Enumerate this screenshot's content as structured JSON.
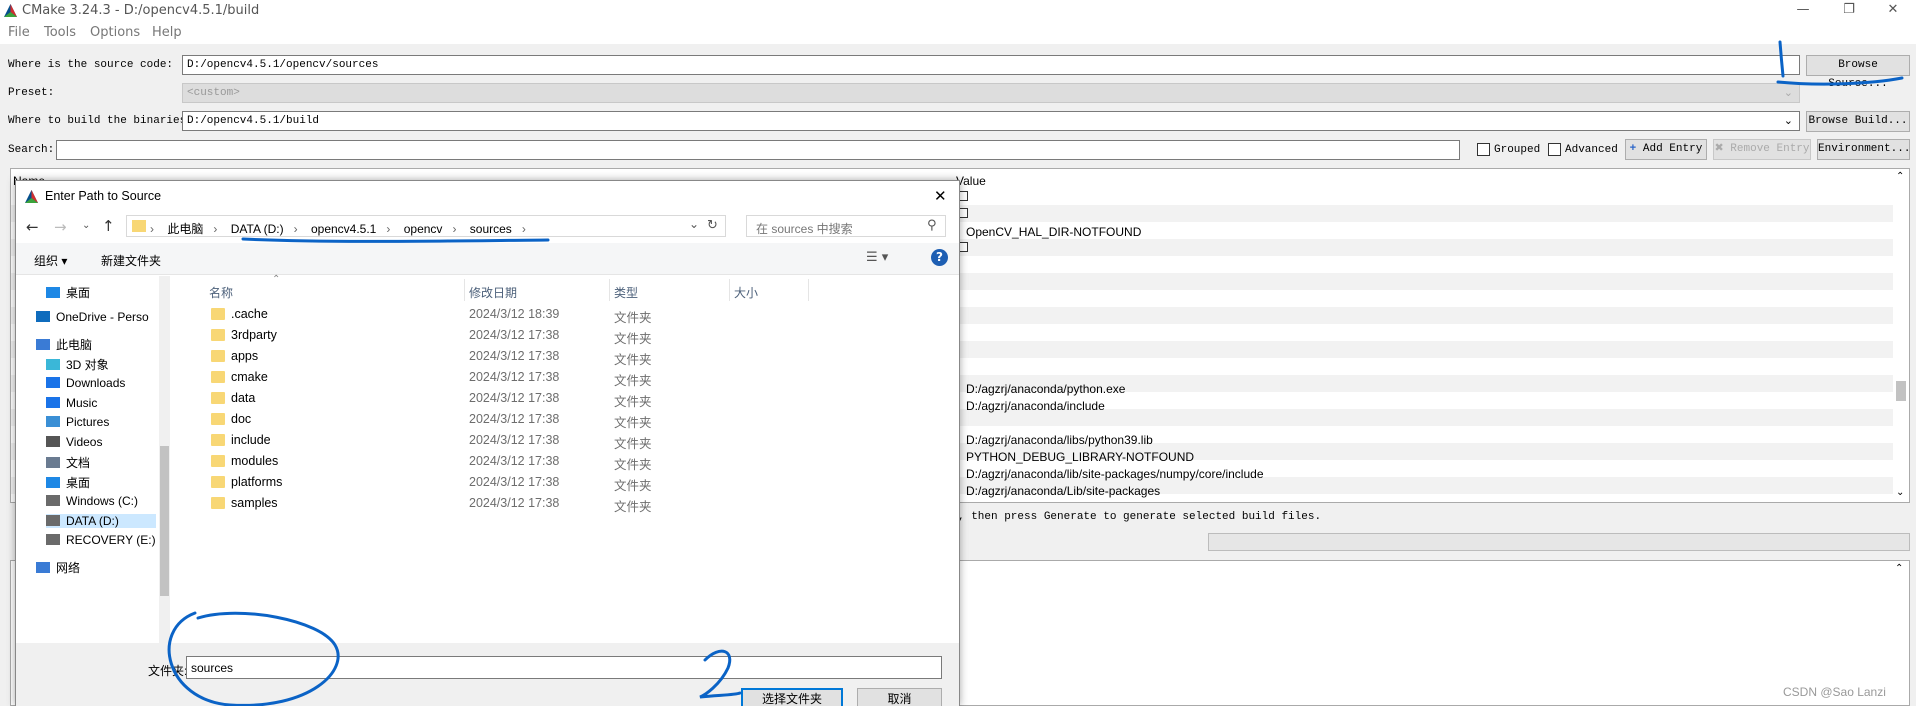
{
  "window": {
    "title": "CMake 3.24.3 - D:/opencv4.5.1/build"
  },
  "menu": [
    "File",
    "Tools",
    "Options",
    "Help"
  ],
  "source": {
    "label": "Where is the source code:",
    "value": "D:/opencv4.5.1/opencv/sources",
    "button": "Browse Source..."
  },
  "preset": {
    "label": "Preset:",
    "value": "<custom>"
  },
  "build": {
    "label": "Where to build the binaries:",
    "value": "D:/opencv4.5.1/build",
    "button": "Browse Build..."
  },
  "search": {
    "label": "Search:",
    "grouped": "Grouped",
    "advanced": "Advanced",
    "add_entry": "Add Entry",
    "remove_entry": "Remove Entry",
    "environment": "Environment..."
  },
  "table": {
    "name_header": "Name",
    "value_header": "Value",
    "values": [
      "",
      "",
      "OpenCV_HAL_DIR-NOTFOUND",
      "",
      "",
      "",
      "",
      "",
      "",
      "",
      "",
      "D:/agzrj/anaconda/python.exe",
      "D:/agzrj/anaconda/include",
      "",
      "D:/agzrj/anaconda/libs/python39.lib",
      "PYTHON_DEBUG_LIBRARY-NOTFOUND",
      "D:/agzrj/anaconda/lib/site-packages/numpy/core/include",
      "D:/agzrj/anaconda/Lib/site-packages"
    ]
  },
  "status_text": ", then press Generate to generate selected build files.",
  "watermark": "CSDN @Sao Lanzi",
  "dialog": {
    "title": "Enter Path to Source",
    "breadcrumb": [
      "此电脑",
      "DATA (D:)",
      "opencv4.5.1",
      "opencv",
      "sources"
    ],
    "search_placeholder": "在 sources 中搜索",
    "organize": "组织 ▾",
    "new_folder": "新建文件夹",
    "nav": [
      {
        "label": "桌面",
        "icon": "desktop-icon",
        "color": "#1e88e5"
      },
      {
        "label": "OneDrive - Perso",
        "icon": "cloud-icon",
        "color": "#0f6cbd"
      },
      {
        "label": "此电脑",
        "icon": "computer-icon",
        "color": "#3a7bd5"
      },
      {
        "label": "3D 对象",
        "icon": "cube-icon",
        "color": "#3ab7d8"
      },
      {
        "label": "Downloads",
        "icon": "download-icon",
        "color": "#1a73e8"
      },
      {
        "label": "Music",
        "icon": "music-icon",
        "color": "#1a73e8"
      },
      {
        "label": "Pictures",
        "icon": "picture-icon",
        "color": "#3a8fd5"
      },
      {
        "label": "Videos",
        "icon": "video-icon",
        "color": "#555555"
      },
      {
        "label": "文档",
        "icon": "document-icon",
        "color": "#6a7b91"
      },
      {
        "label": "桌面",
        "icon": "desktop-icon",
        "color": "#1e88e5"
      },
      {
        "label": "Windows (C:)",
        "icon": "drive-icon",
        "color": "#6a6a6a"
      },
      {
        "label": "DATA (D:)",
        "icon": "drive-icon",
        "color": "#6a6a6a"
      },
      {
        "label": "RECOVERY (E:)",
        "icon": "drive-icon",
        "color": "#6a6a6a"
      },
      {
        "label": "网络",
        "icon": "network-icon",
        "color": "#3a7bd5"
      }
    ],
    "columns": {
      "name": "名称",
      "date": "修改日期",
      "type": "类型",
      "size": "大小"
    },
    "files": [
      {
        "name": ".cache",
        "date": "2024/3/12 18:39",
        "type": "文件夹"
      },
      {
        "name": "3rdparty",
        "date": "2024/3/12 17:38",
        "type": "文件夹"
      },
      {
        "name": "apps",
        "date": "2024/3/12 17:38",
        "type": "文件夹"
      },
      {
        "name": "cmake",
        "date": "2024/3/12 17:38",
        "type": "文件夹"
      },
      {
        "name": "data",
        "date": "2024/3/12 17:38",
        "type": "文件夹"
      },
      {
        "name": "doc",
        "date": "2024/3/12 17:38",
        "type": "文件夹"
      },
      {
        "name": "include",
        "date": "2024/3/12 17:38",
        "type": "文件夹"
      },
      {
        "name": "modules",
        "date": "2024/3/12 17:38",
        "type": "文件夹"
      },
      {
        "name": "platforms",
        "date": "2024/3/12 17:38",
        "type": "文件夹"
      },
      {
        "name": "samples",
        "date": "2024/3/12 17:38",
        "type": "文件夹"
      }
    ],
    "folder_label": "文件夹:",
    "folder_value": "sources",
    "select_button": "选择文件夹",
    "cancel_button": "取消"
  }
}
